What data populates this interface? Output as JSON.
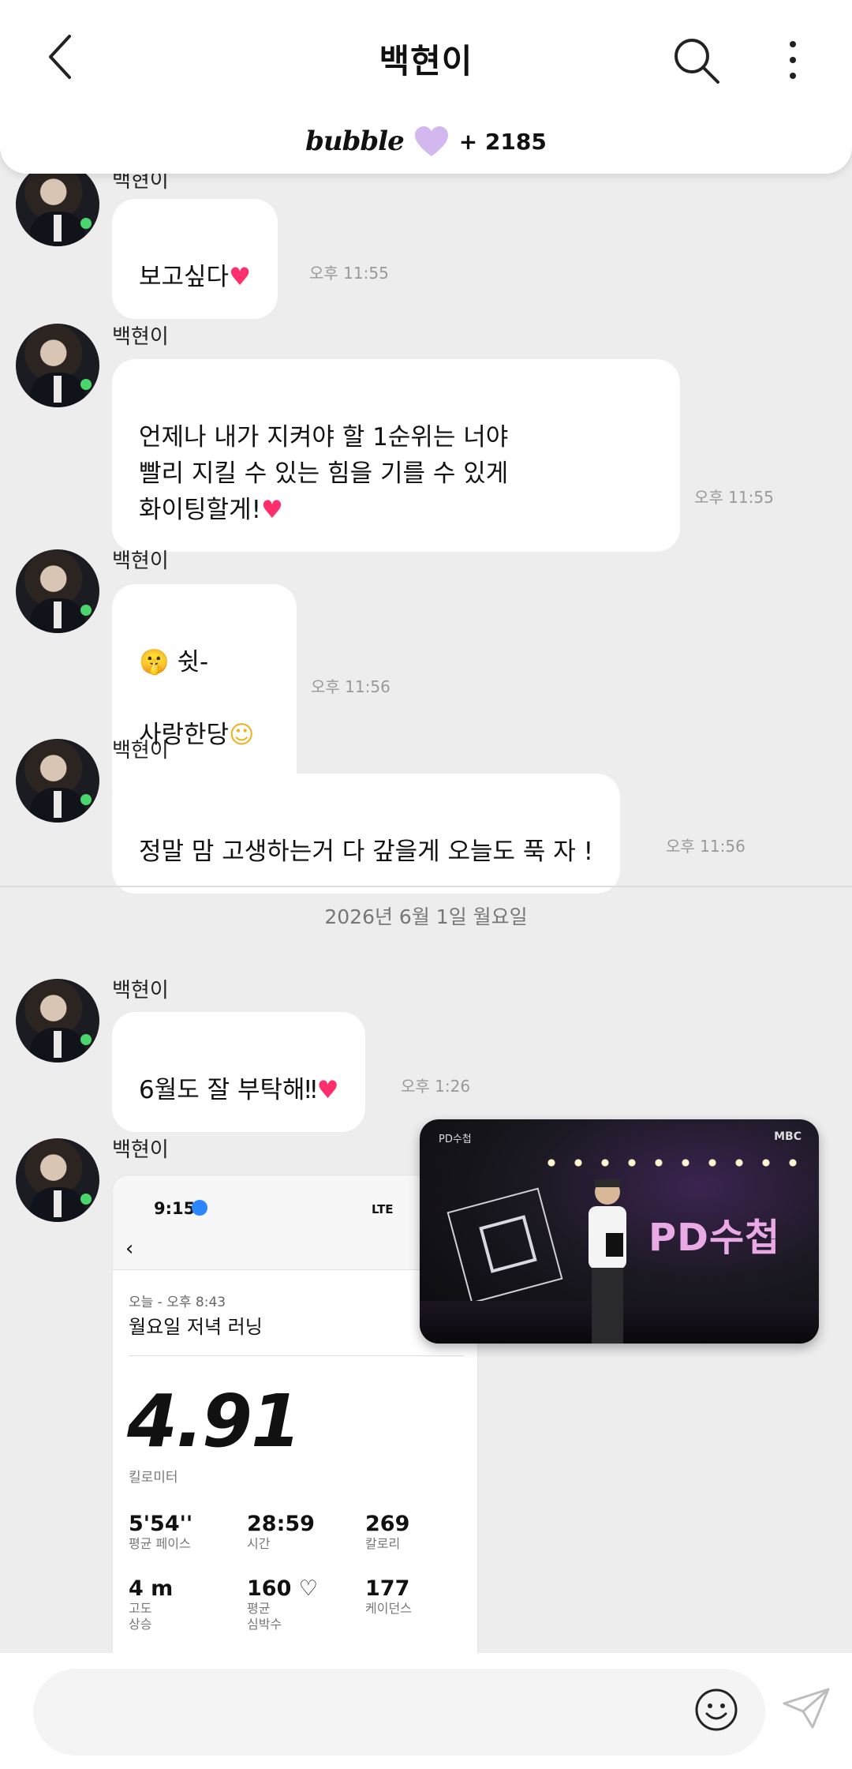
{
  "header": {
    "title": "백현이",
    "bubble_logo": "bubble",
    "bubble_count": "+ 2185"
  },
  "messages": [
    {
      "sender": "백현이",
      "text": "보고싶다",
      "emoji": "♥",
      "time": "오후 11:55"
    },
    {
      "sender": "백현이",
      "text": "언제나 내가 지켜야 할 1순위는 너야\n빨리 지킬 수 있는 힘을 기를 수 있게\n화이팅할게!",
      "emoji": "♥",
      "time": "오후 11:55"
    },
    {
      "sender": "백현이",
      "line1": "🤫 쉿-",
      "line2": "사랑한당",
      "emoji": "☺",
      "time": "오후 11:56"
    },
    {
      "sender": "백현이",
      "text": "정말 맘 고생하는거 다 갚을게 오늘도 푹 자 !",
      "time": "오후 11:56"
    },
    {
      "sender": "백현이",
      "text": "6월도 잘 부탁해‼",
      "emoji": "♥",
      "time": "오후 1:26"
    },
    {
      "sender": "백현이"
    }
  ],
  "date_divider": "2026년 6월 1일 월요일",
  "screenshot_card": {
    "clock": "9:15",
    "signal": "LTE",
    "subtitle": "오늘 - 오후 8:43",
    "run_title": "월요일 저녁 러닝",
    "distance": "4.91",
    "distance_unit": "킬로미터",
    "stats": [
      {
        "value": "5'54''",
        "label": "평균 페이스"
      },
      {
        "value": "28:59",
        "label": "시간"
      },
      {
        "value": "269",
        "label": "칼로리"
      },
      {
        "value": "4 m",
        "label": "고도\n상승"
      },
      {
        "value": "160 ♡",
        "label": "평균\n심박수"
      },
      {
        "value": "177",
        "label": "케이던스"
      }
    ]
  },
  "video_overlay": {
    "corner_left": "PD수첩",
    "corner_right": "MBC",
    "logo_text": "PD수첩"
  },
  "colors": {
    "heart": "#ff2f6d",
    "background": "#ededed",
    "bubble_heart": "#d3b8f0"
  }
}
